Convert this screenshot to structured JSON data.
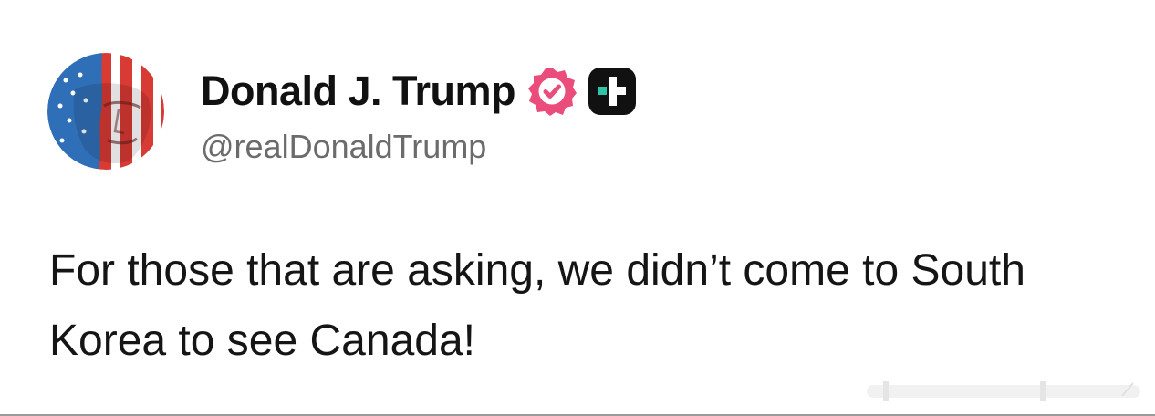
{
  "post": {
    "author": {
      "display_name": "Donald J. Trump",
      "handle": "@realDonaldTrump",
      "verified": true,
      "avatar_icon": "flag-portrait-avatar",
      "verified_icon": "verified-badge-icon",
      "platform_icon": "truth-social-logo-icon"
    },
    "text": "For those that are asking, we didn’t come to South Korea to see Canada!"
  },
  "colors": {
    "verified_badge": "#ea4c7b",
    "platform_badge": "#111111",
    "handle": "#6b6b6b",
    "text": "#151515",
    "background": "#ffffff"
  }
}
